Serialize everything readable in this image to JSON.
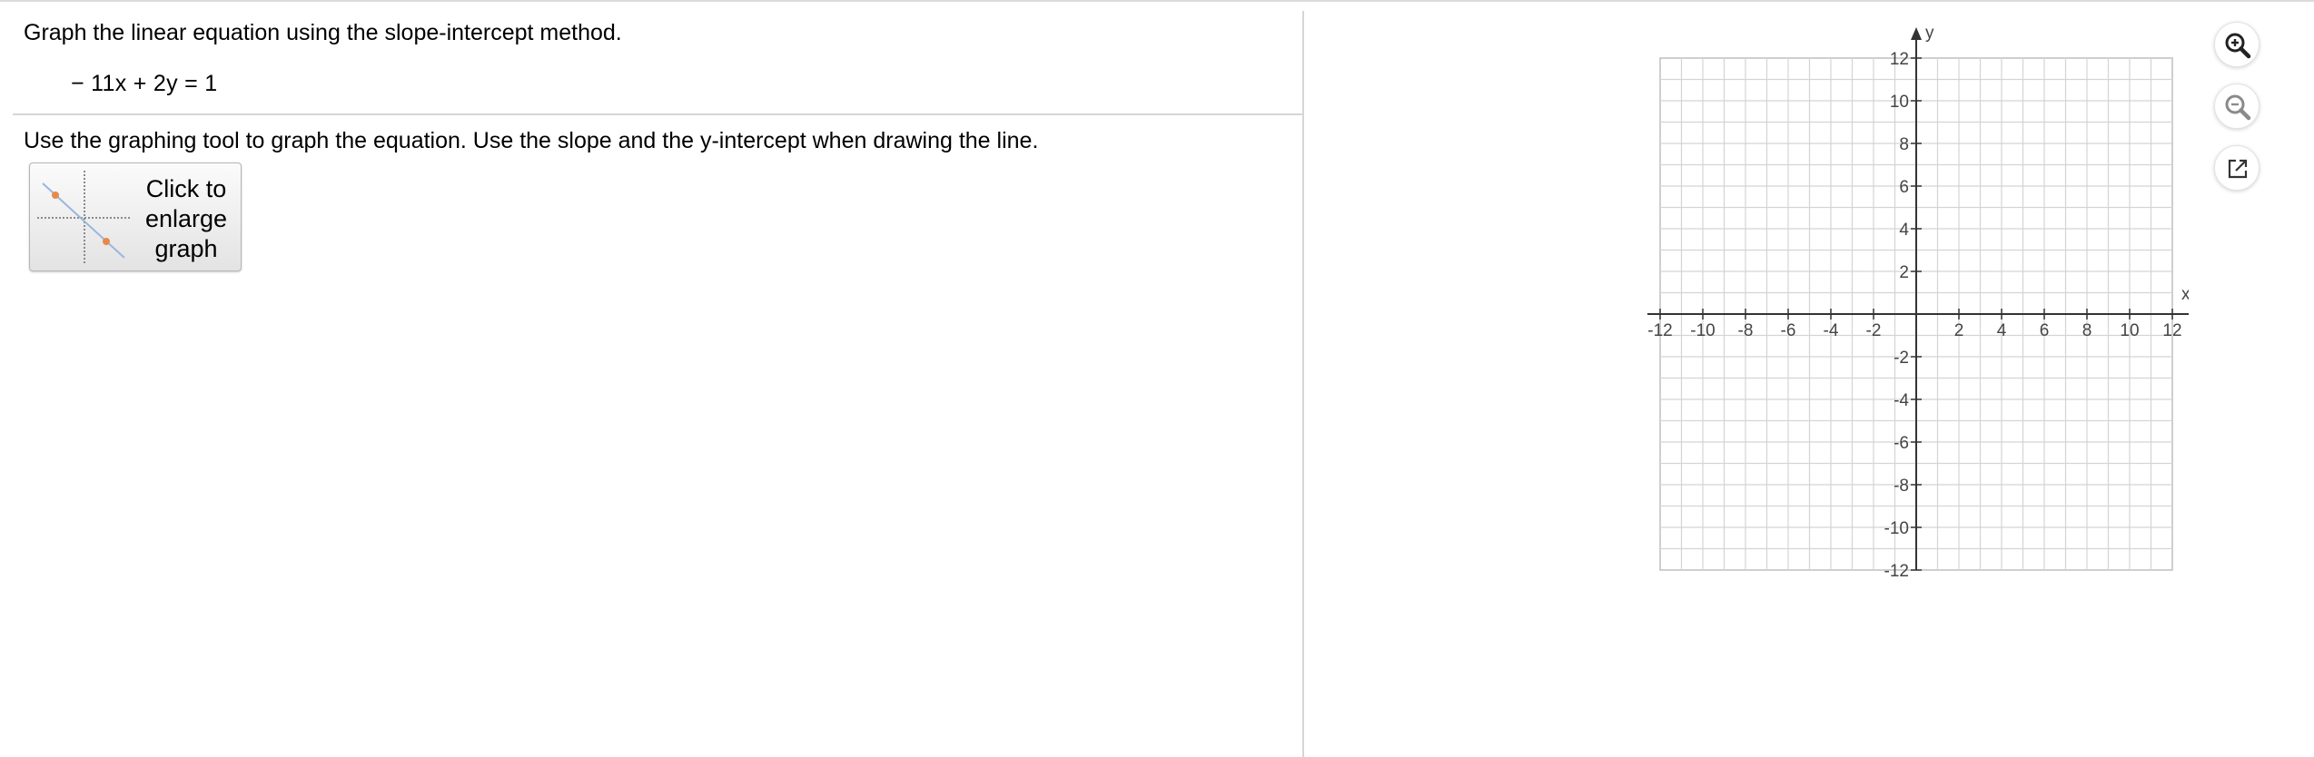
{
  "question": {
    "prompt": "Graph the linear equation using the slope-intercept method.",
    "equation": "− 11x + 2y = 1",
    "instruction": "Use the graphing tool to graph the equation. Use the slope and the y-intercept when drawing the line."
  },
  "enlarge_button": {
    "label": "Click to\nenlarge\ngraph"
  },
  "graph": {
    "x_label": "x",
    "y_label": "y",
    "x_min": -12,
    "x_max": 12,
    "y_min": -12,
    "y_max": 12,
    "grid_step": 1,
    "tick_step": 2,
    "x_tick_labels": [
      "-12",
      "-10",
      "-8",
      "-6",
      "-4",
      "-2",
      "2",
      "4",
      "6",
      "8",
      "10",
      "12"
    ],
    "y_tick_labels": [
      "12",
      "10",
      "8",
      "6",
      "4",
      "2",
      "-2",
      "-4",
      "-6",
      "-8",
      "-10",
      "-12"
    ]
  },
  "tools": {
    "zoom_in": "zoom-in-icon",
    "zoom_out": "zoom-out-icon",
    "pop_out": "pop-out-icon"
  },
  "colors": {
    "grid": "#d4d4d4",
    "axis": "#333333",
    "icon": "#333333"
  }
}
